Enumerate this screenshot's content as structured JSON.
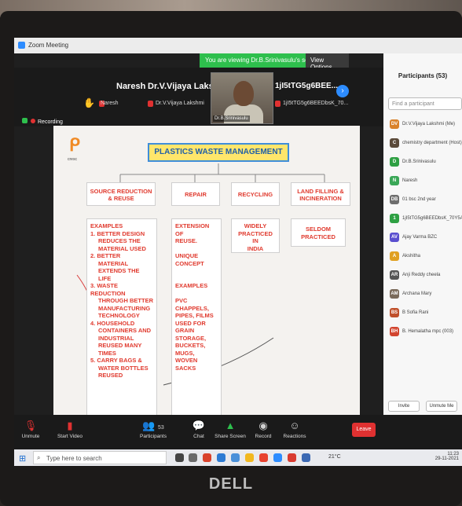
{
  "window": {
    "title": "Zoom Meeting"
  },
  "banner": {
    "text": "You are viewing Dr.B.Srinivasulu's screen",
    "view_options": "View Options ⌄"
  },
  "tiles": [
    {
      "name": "Naresh",
      "sub": "Naresh"
    },
    {
      "name": "Dr.V.Vijaya Laks...",
      "sub": "Dr.V.Vijaya Lakshmi"
    },
    {
      "name": "1jI5tTG5g6BEE...",
      "sub": "1jI5tTG5g6BEEDbsK_70..."
    }
  ],
  "video_label": "Dr.B.Srinivasulu",
  "recording_label": "Recording",
  "slide": {
    "logo_text": "cresc",
    "title": "PLASTICS WASTE MANAGEMENT",
    "headers": [
      "SOURCE REDUCTION & REUSE",
      "REPAIR",
      "RECYCLING",
      "LAND FILLING & INCINERATION"
    ],
    "col1": [
      "EXAMPLES",
      "1. BETTER DESIGN",
      "REDUCES THE",
      "MATERIAL USED",
      "2. BETTER",
      "MATERIAL",
      "EXTENDS THE LIFE",
      "3. WASTE REDUCTION",
      "THROUGH BETTER",
      "MANUFACTURING",
      "TECHNOLOGY",
      "4. HOUSEHOLD",
      "CONTAINERS AND",
      "INDUSTRIAL",
      "REUSED MANY",
      "TIMES",
      "5. CARRY BAGS &",
      "WATER BOTTLES",
      "REUSED"
    ],
    "col2": [
      "EXTENSION OF",
      "REUSE.",
      "",
      "UNIQUE",
      "CONCEPT",
      "",
      "",
      "EXAMPLES",
      "",
      "PVC",
      "CHAPPELS,",
      "PIPES, FILMS",
      "USED FOR",
      "GRAIN",
      "STORAGE,",
      "BUCKETS,",
      "MUGS, WOVEN",
      "SACKS"
    ],
    "col3": [
      "WIDELY",
      "PRACTICED IN",
      "INDIA"
    ],
    "col4": [
      "SELDOM",
      "PRACTICED"
    ]
  },
  "participants_panel": {
    "title": "Participants (53)",
    "search_placeholder": "Find a participant",
    "list": [
      {
        "initials": "DV",
        "name": "Dr.V.Vijaya Lakshmi (Me)",
        "color": "#d9822b"
      },
      {
        "initials": "C",
        "name": "chemistry department (Host)",
        "color": "#5b4a3a"
      },
      {
        "initials": "D",
        "name": "Dr.B.Srinivasulu",
        "color": "#2ea043"
      },
      {
        "initials": "N",
        "name": "Naresh",
        "color": "#3aa757"
      },
      {
        "initials": "DB",
        "name": "01 bsc 2nd year",
        "color": "#6d6d6d"
      },
      {
        "initials": "1",
        "name": "1jI5tTG5g6BEEDbsK_70Y5AAA",
        "color": "#2ea043"
      },
      {
        "initials": "AV",
        "name": "Ajay Varma BZC",
        "color": "#5a4fcf"
      },
      {
        "initials": "A",
        "name": "Akshitha",
        "color": "#e0a020"
      },
      {
        "initials": "AR",
        "name": "Anji Reddy cheela",
        "color": "#555555"
      },
      {
        "initials": "AM",
        "name": "Archana Mary",
        "color": "#7a6a5a"
      },
      {
        "initials": "BS",
        "name": "B Sofia Rani",
        "color": "#c0502b"
      },
      {
        "initials": "BH",
        "name": "B. Hemalatha mpc (003)",
        "color": "#d2452f"
      }
    ],
    "invite_label": "Invite",
    "unmute_label": "Unmute Me"
  },
  "toolbar": {
    "unmute": "Unmute",
    "start_video": "Start Video",
    "participants": "Participants",
    "participants_count": "53",
    "chat": "Chat",
    "share_screen": "Share Screen",
    "record": "Record",
    "reactions": "Reactions",
    "leave": "Leave"
  },
  "taskbar": {
    "search_placeholder": "Type here to search",
    "temp": "21°C",
    "time": "11:23",
    "date": "29-11-2021"
  },
  "brand": "DELL"
}
